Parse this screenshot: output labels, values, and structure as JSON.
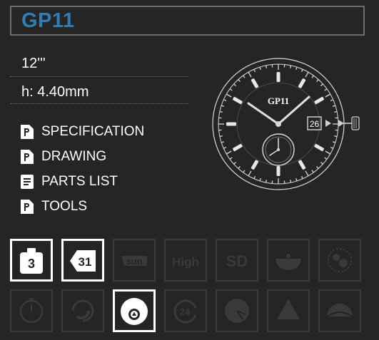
{
  "header": {
    "title": "GP11"
  },
  "specs": {
    "size": "12'''",
    "height": "h: 4.40mm"
  },
  "documents": [
    {
      "label": "SPECIFICATION",
      "icon": "pdf-document-icon"
    },
    {
      "label": "DRAWING",
      "icon": "pdf-document-icon"
    },
    {
      "label": "PARTS LIST",
      "icon": "list-document-icon"
    },
    {
      "label": "TOOLS",
      "icon": "pdf-document-icon"
    }
  ],
  "watch": {
    "brand": "GP11",
    "date": "26"
  },
  "features": {
    "row1": [
      {
        "name": "hour-3-icon",
        "text": "3",
        "active": true
      },
      {
        "name": "date-31-icon",
        "text": "31",
        "active": true
      },
      {
        "name": "sun-icon",
        "text": "sun",
        "active": false
      },
      {
        "name": "high-icon",
        "text": "High",
        "active": false
      },
      {
        "name": "sd-icon",
        "text": "SD",
        "active": false
      },
      {
        "name": "moon-phase-icon",
        "text": "",
        "active": false
      },
      {
        "name": "gears-icon",
        "text": "",
        "active": false
      }
    ],
    "row2": [
      {
        "name": "chrono-icon",
        "text": "",
        "active": false
      },
      {
        "name": "automatic-icon",
        "text": "",
        "active": false
      },
      {
        "name": "small-seconds-icon",
        "text": "",
        "active": true
      },
      {
        "name": "24h-icon",
        "text": "24",
        "active": false
      },
      {
        "name": "power-reserve-icon",
        "text": "",
        "active": false
      },
      {
        "name": "tourbillon-icon",
        "text": "",
        "active": false
      },
      {
        "name": "day-night-icon",
        "text": "",
        "active": false
      }
    ]
  },
  "colors": {
    "background": "#252525",
    "accent": "#2f7fb6",
    "border": "#6c6c6c",
    "inactive": "#3a3a3a"
  }
}
